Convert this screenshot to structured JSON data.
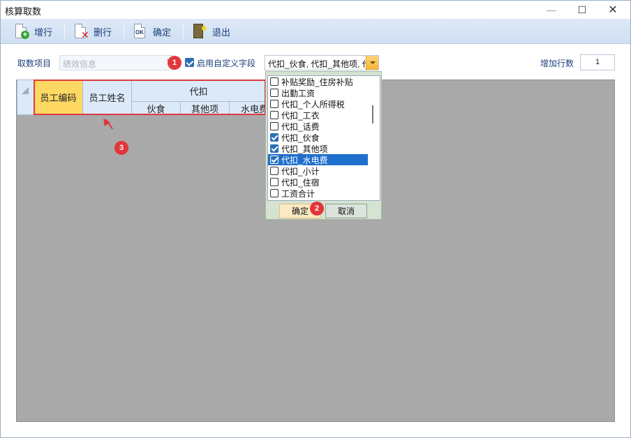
{
  "window": {
    "title": "核算取数",
    "min": "—",
    "max": "☐",
    "close": "✕"
  },
  "toolbar": {
    "add_row": "增行",
    "delete_row": "删行",
    "confirm": "确定",
    "exit": "退出"
  },
  "form": {
    "source_label": "取数项目",
    "source_value": "绩效信息",
    "custom_fields_label": "启用自定义字段",
    "custom_fields_checked": true,
    "fields_value": "代扣_伙食, 代扣_其他项, 代扣_水电费",
    "add_rows_label": "增加行数",
    "add_rows_value": "1"
  },
  "grid": {
    "headers": {
      "emp_code": "员工编码",
      "emp_name": "员工姓名",
      "group": "代扣",
      "sub": [
        "伙食",
        "其他项",
        "水电费"
      ]
    }
  },
  "dropdown": {
    "items": [
      {
        "label": "补贴奖励_住房补贴",
        "checked": false,
        "selected": false
      },
      {
        "label": "出勤工资",
        "checked": false,
        "selected": false
      },
      {
        "label": "代扣_个人所得税",
        "checked": false,
        "selected": false
      },
      {
        "label": "代扣_工衣",
        "checked": false,
        "selected": false
      },
      {
        "label": "代扣_话费",
        "checked": false,
        "selected": false
      },
      {
        "label": "代扣_伙食",
        "checked": true,
        "selected": false
      },
      {
        "label": "代扣_其他项",
        "checked": true,
        "selected": false
      },
      {
        "label": "代扣_水电费",
        "checked": true,
        "selected": true
      },
      {
        "label": "代扣_小计",
        "checked": false,
        "selected": false
      },
      {
        "label": "代扣_住宿",
        "checked": false,
        "selected": false
      },
      {
        "label": "工资合计",
        "checked": false,
        "selected": false
      }
    ],
    "ok": "确定",
    "cancel": "取消"
  },
  "annotations": {
    "badge1": "1",
    "badge2": "2",
    "badge3": "3"
  }
}
